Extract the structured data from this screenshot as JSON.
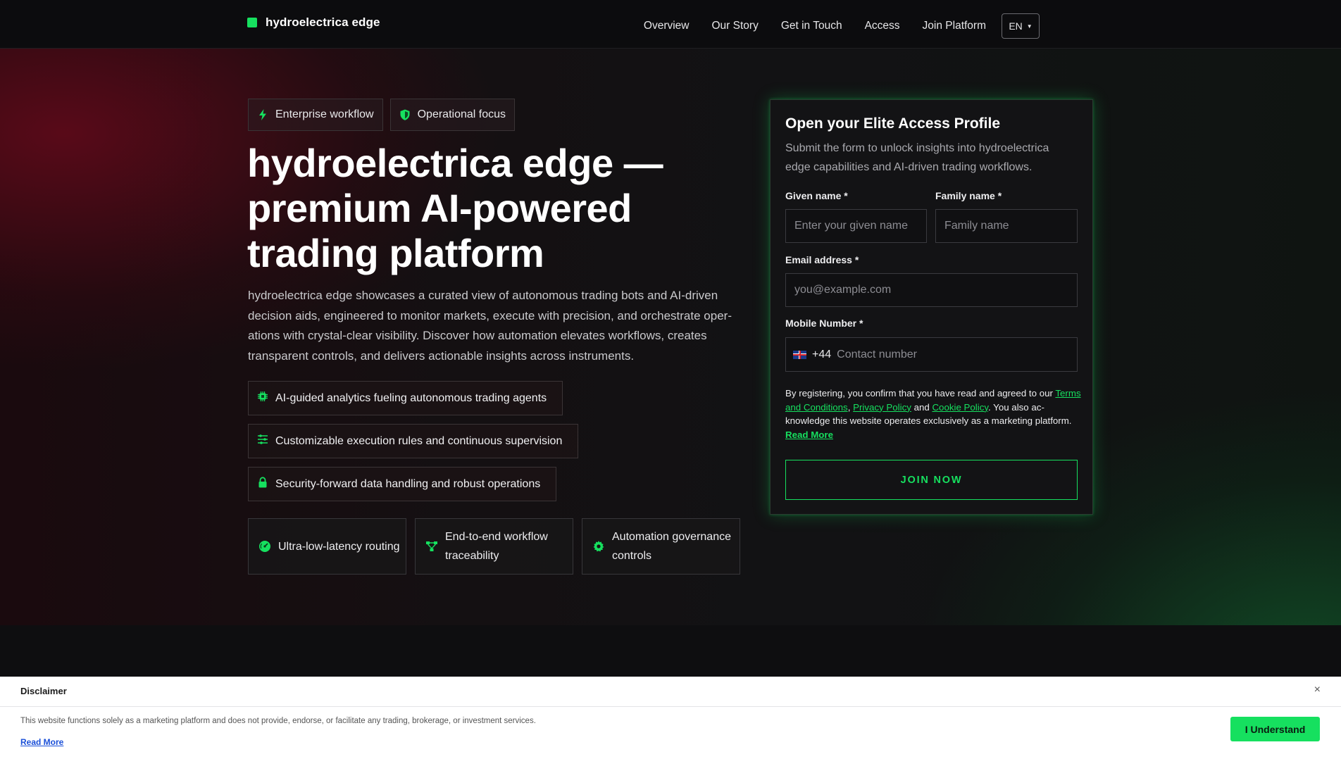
{
  "brand": {
    "name": "hydroelectrica edge",
    "accent": "#16e05f"
  },
  "nav": {
    "links": [
      "Overview",
      "Our Story",
      "Get in Touch",
      "Access",
      "Join Platform"
    ],
    "language": "EN"
  },
  "hero": {
    "tags": [
      {
        "label": "Enterprise workflow",
        "icon": "bolt-icon"
      },
      {
        "label": "Operational focus",
        "icon": "shield-icon"
      }
    ],
    "headline": "hydroelectrica edge — premium AI-powered trading platform",
    "lede": "hydroelectrica edge showcases a curated view of autonomous trading bots and AI-driven decision aids, engineered to monitor markets, execute with precision, and orchestrate oper­ations with crystal-clear visibility. Discover how automation elevates workflows, creates transparent controls, and delivers actionable insights across instruments.",
    "features": [
      {
        "label": "AI-guided analytics fueling autonomous trading agents",
        "icon": "chip-icon"
      },
      {
        "label": "Customizable execution rules and continuous supervision",
        "icon": "sliders-icon"
      },
      {
        "label": "Security-forward data handling and robust operations",
        "icon": "lock-icon"
      }
    ],
    "cards": [
      {
        "label": "Ultra-low-latency routing",
        "icon": "gauge-icon"
      },
      {
        "label": "End-to-end workflow traceability",
        "icon": "flow-icon"
      },
      {
        "label": "Automation governance controls",
        "icon": "gear-icon"
      }
    ]
  },
  "form": {
    "title": "Open your Elite Access Profile",
    "subtitle": "Submit the form to unlock insights into hydroelectrica edge capabilities and AI-driven trading workflows.",
    "given_name": {
      "label": "Given name *",
      "placeholder": "Enter your given name"
    },
    "family_name": {
      "label": "Family name *",
      "placeholder": "Family name"
    },
    "email": {
      "label": "Email address *",
      "placeholder": "you@example.com"
    },
    "mobile": {
      "label": "Mobile Number *",
      "dial_code": "+44",
      "placeholder": "Contact number",
      "flag_icon": "uk-flag-icon"
    },
    "legal": {
      "prefix": "By registering, you confirm that you have read and agreed to our ",
      "terms": "Terms and Conditions",
      "comma": ", ",
      "privacy": "Privacy Policy",
      "and": " and ",
      "cookie": "Cookie Policy",
      "suffix": ". You also ac­knowledge this website operates exclusively as a marketing platform.",
      "read_more": "Read More"
    },
    "submit": "JOIN NOW"
  },
  "disclaimer": {
    "title": "Disclaimer",
    "text": "This website functions solely as a marketing platform and does not provide, endorse, or facilitate any trading, brokerage, or investment services.",
    "read_more": "Read More",
    "button": "I Understand",
    "close": "×"
  }
}
